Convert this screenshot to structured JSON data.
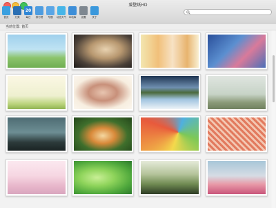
{
  "window": {
    "title": "爱壁纸HD"
  },
  "toolbar": {
    "items": [
      {
        "label": "首页",
        "icon": "home-icon",
        "color": "#3aa0e0"
      },
      {
        "label": "分类",
        "icon": "category-icon",
        "color": "#2b6fb3"
      },
      {
        "label": "每日",
        "icon": "calendar-icon",
        "color": "#2f86d6",
        "text": "20"
      },
      {
        "label": "排行榜",
        "icon": "ranking-icon",
        "color": "#4d9ce0"
      },
      {
        "label": "专题",
        "icon": "topic-icon",
        "color": "#5aa6e6"
      },
      {
        "label": "动态天气",
        "icon": "weather-icon",
        "color": "#46b5e8"
      },
      {
        "label": "本地库",
        "icon": "library-icon",
        "color": "#3d8ed8"
      },
      {
        "label": "设置",
        "icon": "gear-icon",
        "color": "#7e8790"
      },
      {
        "label": "关于",
        "icon": "about-gear-icon",
        "color": "#3a98dc"
      }
    ]
  },
  "search": {
    "placeholder": "",
    "value": ""
  },
  "breadcrumb": {
    "text": "当前位置: 首页"
  },
  "gallery": {
    "thumbnails": [
      {
        "name": "thumb-cartoon-bears",
        "bg": "linear-gradient(180deg,#9fd0ec 0%,#bfe3f3 45%,#8cc46c 70%,#6fae52 100%)"
      },
      {
        "name": "thumb-blonde-woman",
        "bg": "radial-gradient(ellipse at 55% 45%,#e8d2b0 0%,#b89870 35%,#4a4038 70%,#1e1c1a 100%)"
      },
      {
        "name": "thumb-autumn-trees",
        "bg": "linear-gradient(90deg,#f3e6b0 0%,#f1c07a 30%,#f7e2c4 55%,#e8b46e 80%,#f9efd2 100%)"
      },
      {
        "name": "thumb-rain-window",
        "bg": "linear-gradient(135deg,#2a4f9a 0%,#5b8fd0 40%,#d97a9a 65%,#4a6fb8 100%)"
      },
      {
        "name": "thumb-green-sapling",
        "bg": "linear-gradient(180deg,#fbf7e4 0%,#eef0cf 60%,#b9d37a 85%,#8fb352 100%)"
      },
      {
        "name": "thumb-girl-portrait",
        "bg": "radial-gradient(ellipse at 50% 50%,#e8c5b0 0%,#c8907a 35%,#f7eee0 70%,#fbf6ee 100%)"
      },
      {
        "name": "thumb-lake-reflection",
        "bg": "linear-gradient(180deg,#1f3552 0%,#6f8fb0 35%,#4b6a3c 50%,#9fc3df 70%,#eef4f8 100%)"
      },
      {
        "name": "thumb-woman-field",
        "bg": "linear-gradient(180deg,#dfe5e0 0%,#c7d3c6 55%,#8a9a78 80%,#6f805e 100%)"
      },
      {
        "name": "thumb-dark-tree",
        "bg": "linear-gradient(180deg,#4e6c73 0%,#6d8e94 45%,#2c3a3a 75%,#1b2424 100%)"
      },
      {
        "name": "thumb-scarecrow",
        "bg": "radial-gradient(ellipse at 50% 55%,#f4d7a0 0%,#d98a3a 30%,#3f6f2c 60%,#23461a 100%)"
      },
      {
        "name": "thumb-umbrella",
        "bg": "conic-gradient(from 200deg at 65% 45%,#f4d94c,#e85a3c,#4fb0e0,#7dc857,#f4d94c)"
      },
      {
        "name": "thumb-starbucks-pattern",
        "bg": "repeating-linear-gradient(45deg,#e27a5e 0px,#e27a5e 3px,#f3c7b2 3px,#f3c7b2 6px)"
      },
      {
        "name": "thumb-girl-group",
        "bg": "linear-gradient(180deg,#fbe8ef 0%,#f6d6e2 45%,#e8b7cb 75%,#d9a6bf 100%)"
      },
      {
        "name": "thumb-green-leaves",
        "bg": "radial-gradient(ellipse at 40% 50%,#c9ef96 0%,#8fd45b 35%,#4fa83c 70%,#2c7a2c 100%)"
      },
      {
        "name": "thumb-fence",
        "bg": "linear-gradient(180deg,#e4ead8 0%,#b4c39a 40%,#6f8a52 70%,#2d3b24 100%)"
      },
      {
        "name": "thumb-car-toy",
        "bg": "linear-gradient(180deg,#a8c6d8 0%,#d6dce4 45%,#e89aa8 70%,#c9557a 100%)"
      }
    ]
  }
}
